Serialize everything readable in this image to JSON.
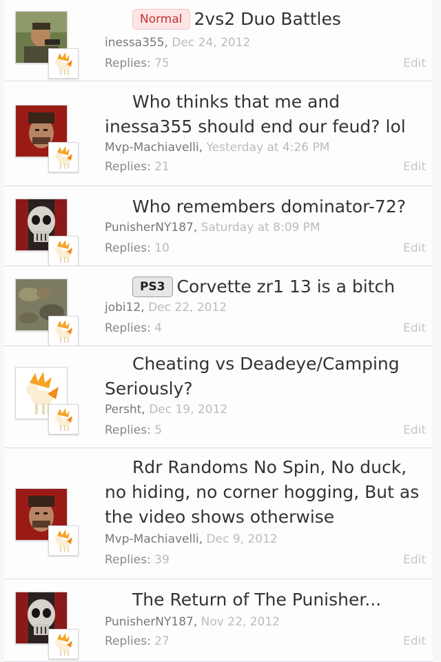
{
  "threads": [
    {
      "prefix": "Normal",
      "title": "2vs2 Duo Battles",
      "author": "inessa355",
      "date": "Dec 24, 2012",
      "replies_label": "Replies:",
      "replies": "75",
      "edit": "Edit"
    },
    {
      "prefix": "",
      "title": "Who thinks that me and inessa355 should end our feud? lol",
      "author": "Mvp-Machiavelli",
      "date": "Yesterday at 4:26 PM",
      "replies_label": "Replies:",
      "replies": "21",
      "edit": "Edit"
    },
    {
      "prefix": "",
      "title": "Who remembers dominator-72?",
      "author": "PunisherNY187",
      "date": "Saturday at 8:09 PM",
      "replies_label": "Replies:",
      "replies": "10",
      "edit": "Edit"
    },
    {
      "prefix": "PS3",
      "title": "Corvette zr1 13 is a bitch",
      "author": "jobi12",
      "date": "Dec 22, 2012",
      "replies_label": "Replies:",
      "replies": "4",
      "edit": "Edit"
    },
    {
      "prefix": "",
      "title": "Cheating vs Deadeye/Camping Seriously?",
      "author": "Persht",
      "date": "Dec 19, 2012",
      "replies_label": "Replies:",
      "replies": "5",
      "edit": "Edit"
    },
    {
      "prefix": "",
      "title": "Rdr Randoms No Spin, No duck, no hiding, no corner hogging, But as the video shows otherwise",
      "author": "Mvp-Machiavelli",
      "date": "Dec 9, 2012",
      "replies_label": "Replies:",
      "replies": "39",
      "edit": "Edit"
    },
    {
      "prefix": "",
      "title": "The Return of The Punisher...",
      "author": "PunisherNY187",
      "date": "Nov 22, 2012",
      "replies_label": "Replies:",
      "replies": "27",
      "edit": "Edit"
    }
  ],
  "colors": {
    "prefix_normal": "#c13030",
    "prefix_ps3": "#222222",
    "text": "#333333",
    "muted": "#bbbbbb"
  },
  "icons": {
    "avatar_badge": "ponyta-icon"
  }
}
